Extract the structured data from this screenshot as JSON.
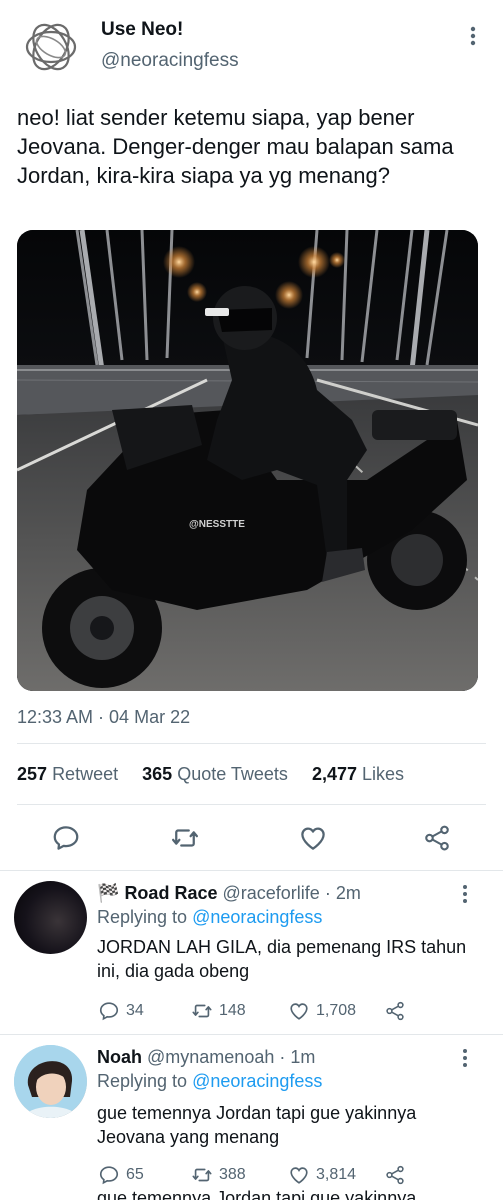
{
  "tweet": {
    "account_name": "Use Neo!",
    "account_handle": "@neoracingfess",
    "text": "neo! liat sender ketemu siapa, yap bener Jeovana. Denger-denger mau balapan sama Jordan, kira-kira siapa ya yg menang?",
    "photo_watermark": "@NESSTTE",
    "timestamp": "12:33 AM · 04 Mar 22",
    "stats": {
      "retweets_count": "257",
      "retweets_label": "Retweet",
      "quotes_count": "365",
      "quotes_label": "Quote Tweets",
      "likes_count": "2,477",
      "likes_label": "Likes"
    }
  },
  "replies": [
    {
      "emoji": "🏁",
      "name": "Road Race",
      "handle": "@raceforlife",
      "time": "· 2m",
      "replying_prefix": "Replying to",
      "replying_to": "@neoracingfess",
      "text": "JORDAN LAH GILA, dia pemenang IRS tahun ini, dia gada obeng",
      "reply_count": "34",
      "retweet_count": "148",
      "like_count": "1,708"
    },
    {
      "name": "Noah",
      "handle": "@mynamenoah",
      "time": "· 1m",
      "replying_prefix": "Replying to",
      "replying_to": "@neoracingfess",
      "text": "gue temennya Jordan tapi gue yakinnya Jeovana yang menang",
      "reply_count": "65",
      "retweet_count": "388",
      "like_count": "3,814"
    }
  ],
  "partial_next_text": "gue temennya Jordan tapi gue yakinnya",
  "colors": {
    "accent": "#1d9bf0",
    "muted": "#536471",
    "text": "#0f1419",
    "divider": "#e3e7ea"
  }
}
